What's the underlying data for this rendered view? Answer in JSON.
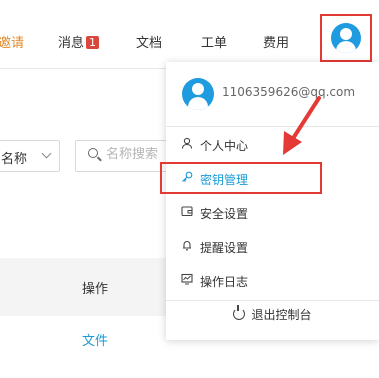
{
  "topbar": {
    "invite_label": "邀请",
    "messages_label": "消息",
    "messages_badge": "1",
    "docs_label": "文档",
    "orders_label": "工单",
    "fees_label": "费用"
  },
  "filters": {
    "name_select": "名称",
    "search_placeholder": "名称搜索"
  },
  "table": {
    "ops_header": "操作",
    "row_link": "文件"
  },
  "user_menu": {
    "email": "1106359626@qq.com",
    "items": [
      {
        "label": "个人中心",
        "icon": "user-icon"
      },
      {
        "label": "密钥管理",
        "icon": "key-icon",
        "active": true
      },
      {
        "label": "安全设置",
        "icon": "wallet-icon"
      },
      {
        "label": "提醒设置",
        "icon": "bell-icon"
      },
      {
        "label": "操作日志",
        "icon": "log-icon"
      }
    ],
    "logout_label": "退出控制台"
  },
  "colors": {
    "accent": "#1a9bd7",
    "annotation_red": "#e53935",
    "invite_orange": "#e2892a",
    "badge_red": "#d9463b"
  }
}
